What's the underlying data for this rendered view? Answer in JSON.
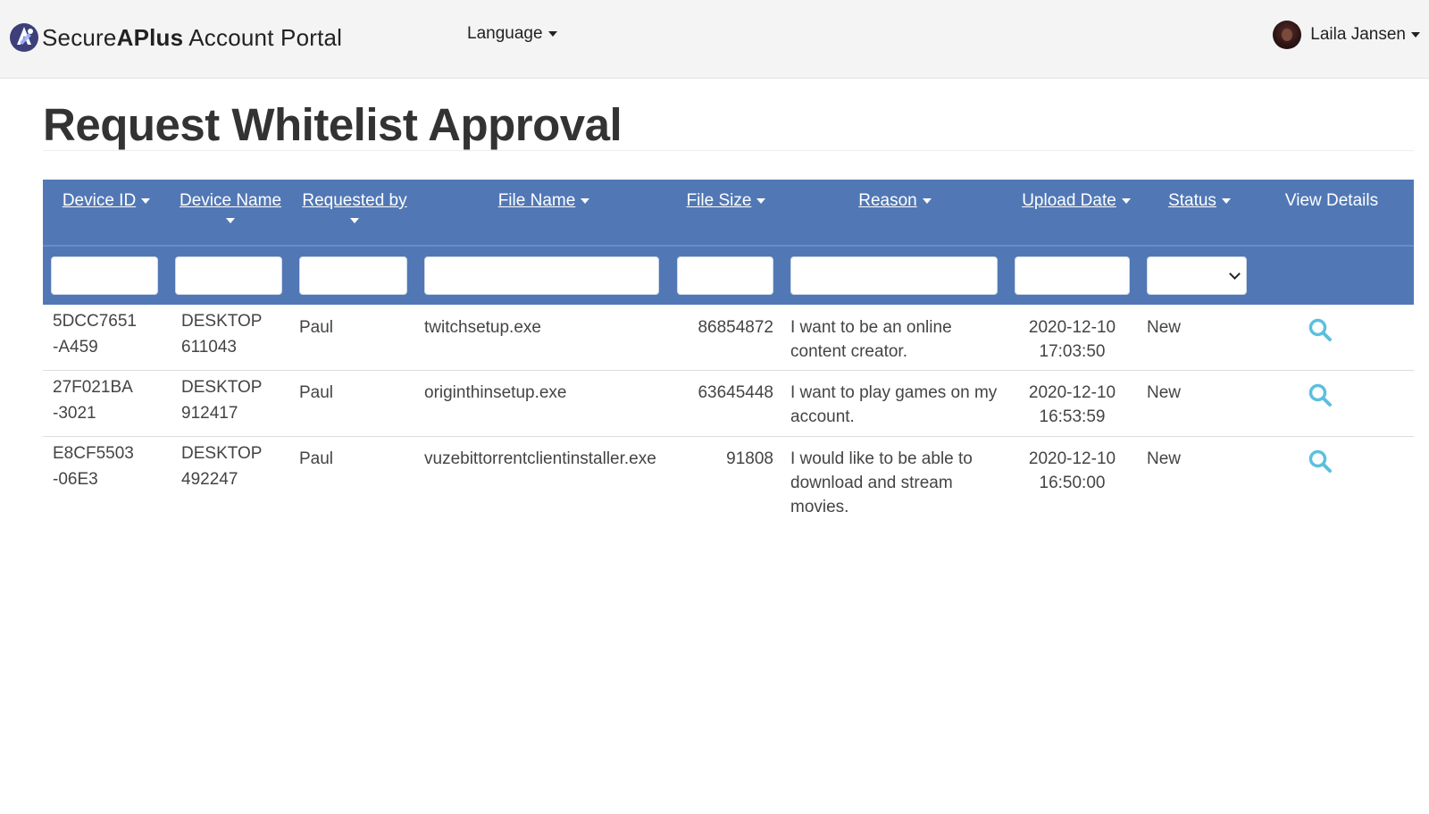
{
  "app": {
    "brand_prefix": "Secure",
    "brand_bold": "APlus",
    "brand_suffix": " Account Portal",
    "language_label": "Language",
    "user_name": "Laila Jansen"
  },
  "page": {
    "title": "Request Whitelist Approval"
  },
  "table": {
    "columns": {
      "device_id": "Device ID",
      "device_name": "Device Name",
      "requested_by": "Requested by",
      "file_name": "File Name",
      "file_size": "File Size",
      "reason": "Reason",
      "upload_date": "Upload Date",
      "status": "Status",
      "view_details": "View Details"
    },
    "rows": [
      {
        "device_id_1": "5DCC7651",
        "device_id_2": "-A459",
        "device_name_1": "DESKTOP",
        "device_name_2": "611043",
        "requested_by": "Paul",
        "file_name": "twitchsetup.exe",
        "file_size": "86854872",
        "reason": "I want to be an online content creator.",
        "upload_date_1": "2020-12-10",
        "upload_date_2": "17:03:50",
        "status": "New"
      },
      {
        "device_id_1": "27F021BA",
        "device_id_2": "-3021",
        "device_name_1": "DESKTOP",
        "device_name_2": "912417",
        "requested_by": "Paul",
        "file_name": "originthinsetup.exe",
        "file_size": "63645448",
        "reason": "I want to play games on my account.",
        "upload_date_1": "2020-12-10",
        "upload_date_2": "16:53:59",
        "status": "New"
      },
      {
        "device_id_1": "E8CF5503",
        "device_id_2": "-06E3",
        "device_name_1": "DESKTOP",
        "device_name_2": "492247",
        "requested_by": "Paul",
        "file_name": "vuzebittorrentclientinstaller.exe",
        "file_size": "91808",
        "reason": "I would like to be able to download and stream movies.",
        "upload_date_1": "2020-12-10",
        "upload_date_2": "16:50:00",
        "status": "New"
      }
    ]
  },
  "colors": {
    "header_blue": "#5178b5",
    "icon_blue": "#5bc0de",
    "navbar_bg": "#f4f4f4"
  }
}
